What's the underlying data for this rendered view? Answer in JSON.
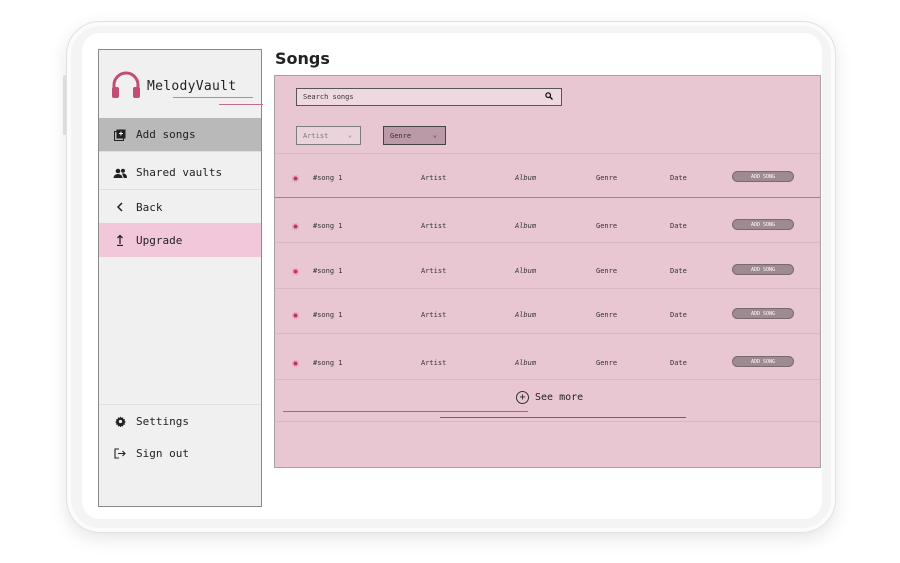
{
  "app": {
    "brand": "MelodyVault",
    "page_title": "Songs",
    "accent_color": "#c76a8c",
    "logo_icon": "headphones-icon"
  },
  "sidebar": {
    "items": [
      {
        "label": "Add songs",
        "icon": "add-library-icon"
      },
      {
        "label": "Shared vaults",
        "icon": "people-icon"
      },
      {
        "label": "Back",
        "icon": "chevron-left-icon"
      },
      {
        "label": "Upgrade",
        "icon": "upload-arrow-icon"
      }
    ],
    "bottom": [
      {
        "label": "Settings",
        "icon": "gear-icon"
      },
      {
        "label": "Sign out",
        "icon": "sign-out-icon"
      }
    ]
  },
  "search": {
    "placeholder": "Search songs"
  },
  "filters": {
    "artist": "Artist",
    "genre": "Genre"
  },
  "songs": [
    {
      "song": "#song 1",
      "artist": "Artist",
      "album": "Album",
      "genre": "Genre",
      "date": "Date",
      "action": "ADD SONG"
    },
    {
      "song": "#song 1",
      "artist": "Artist",
      "album": "Album",
      "genre": "Genre",
      "date": "Date",
      "action": "ADD SONG"
    },
    {
      "song": "#song 1",
      "artist": "Artist",
      "album": "Album",
      "genre": "Genre",
      "date": "Date",
      "action": "ADD SONG"
    },
    {
      "song": "#song 1",
      "artist": "Artist",
      "album": "Album",
      "genre": "Genre",
      "date": "Date",
      "action": "ADD SONG"
    },
    {
      "song": "#song 1",
      "artist": "Artist",
      "album": "Album",
      "genre": "Genre",
      "date": "Date",
      "action": "ADD SONG"
    }
  ],
  "see_more": "See more"
}
